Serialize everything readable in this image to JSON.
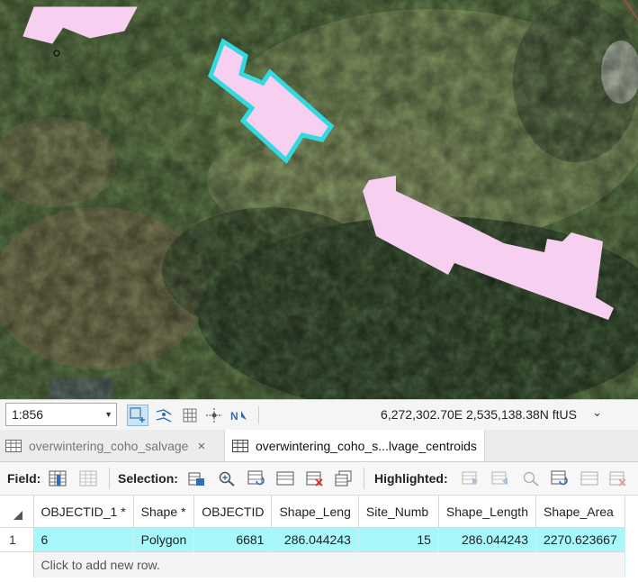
{
  "map": {
    "polygon_fill": "#f6cff1",
    "selected_outline": "#33d9de"
  },
  "map_status": {
    "scale": "1:856",
    "coordinates": "6,272,302.70E 2,535,138.38N ftUS"
  },
  "tabs": [
    {
      "label": "overwintering_coho_salvage",
      "close": "×"
    },
    {
      "label": "overwintering_coho_s...lvage_centroids"
    }
  ],
  "toolbar": {
    "field_label": "Field:",
    "selection_label": "Selection:",
    "highlighted_label": "Highlighted:"
  },
  "table": {
    "columns": [
      "OBJECTID_1 *",
      "Shape *",
      "OBJECTID",
      "Shape_Leng",
      "Site_Numb",
      "Shape_Length",
      "Shape_Area"
    ],
    "rows": [
      {
        "num": "1",
        "cells": [
          "6",
          "Polygon",
          "6681",
          "286.044243",
          "15",
          "286.044243",
          "2270.623667"
        ]
      }
    ],
    "add_row_text": "Click to add new row.",
    "selected_row_color": "#a8f7fa"
  }
}
